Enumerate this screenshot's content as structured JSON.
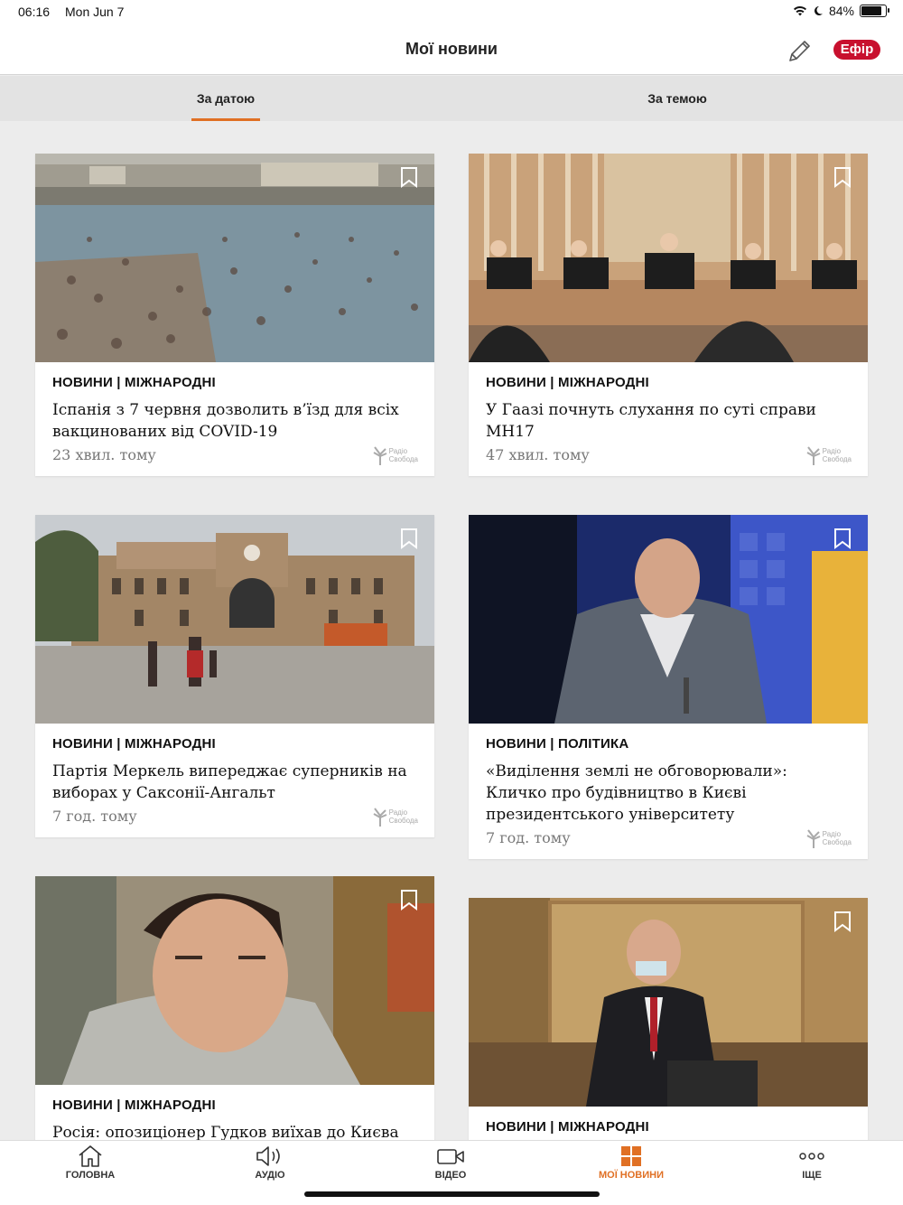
{
  "status_bar": {
    "time": "06:16",
    "date": "Mon Jun 7",
    "battery": "84%",
    "battery_level": 0.84
  },
  "header": {
    "title": "Мої новини",
    "live_label": "Ефір"
  },
  "tabs": [
    {
      "label": "За датою",
      "active": true
    },
    {
      "label": "За темою",
      "active": false
    }
  ],
  "logo_text": {
    "line1": "Радіо",
    "line2": "Свобода"
  },
  "articles": [
    {
      "category": "НОВИНИ | МІЖНАРОДНІ",
      "headline": "Іспанія з 7 червня дозволить в’їзд для всіх вакцинованих від COVID-19",
      "time_ago": "23 хвил. тому"
    },
    {
      "category": "НОВИНИ | МІЖНАРОДНІ",
      "headline": "У Гаазі почнуть слухання по суті справи MH17",
      "time_ago": "47 хвил. тому"
    },
    {
      "category": "НОВИНИ | МІЖНАРОДНІ",
      "headline": "Партія Меркель випереджає суперників на виборах у Саксонії-Ангальт",
      "time_ago": "7 год. тому"
    },
    {
      "category": "НОВИНИ | ПОЛІТИКА",
      "headline": "«Виділення землі не обговорювали»: Кличко про будівництво в Києві президентського університету",
      "time_ago": "7 год. тому"
    },
    {
      "category": "НОВИНИ | МІЖНАРОДНІ",
      "headline": "Росія: опозиціонер Гудков виїхав до Києва"
    },
    {
      "category": "НОВИНИ | МІЖНАРОДНІ"
    }
  ],
  "bottom_nav": [
    {
      "label": "ГОЛОВНА",
      "icon": "home-icon"
    },
    {
      "label": "АУДІО",
      "icon": "audio-icon"
    },
    {
      "label": "ВІДЕО",
      "icon": "video-icon"
    },
    {
      "label": "МОЇ НОВИНИ",
      "icon": "grid-icon",
      "active": true
    },
    {
      "label": "ІЩЕ",
      "icon": "more-icon"
    }
  ],
  "colors": {
    "accent": "#e07024",
    "live": "#c8102e"
  }
}
